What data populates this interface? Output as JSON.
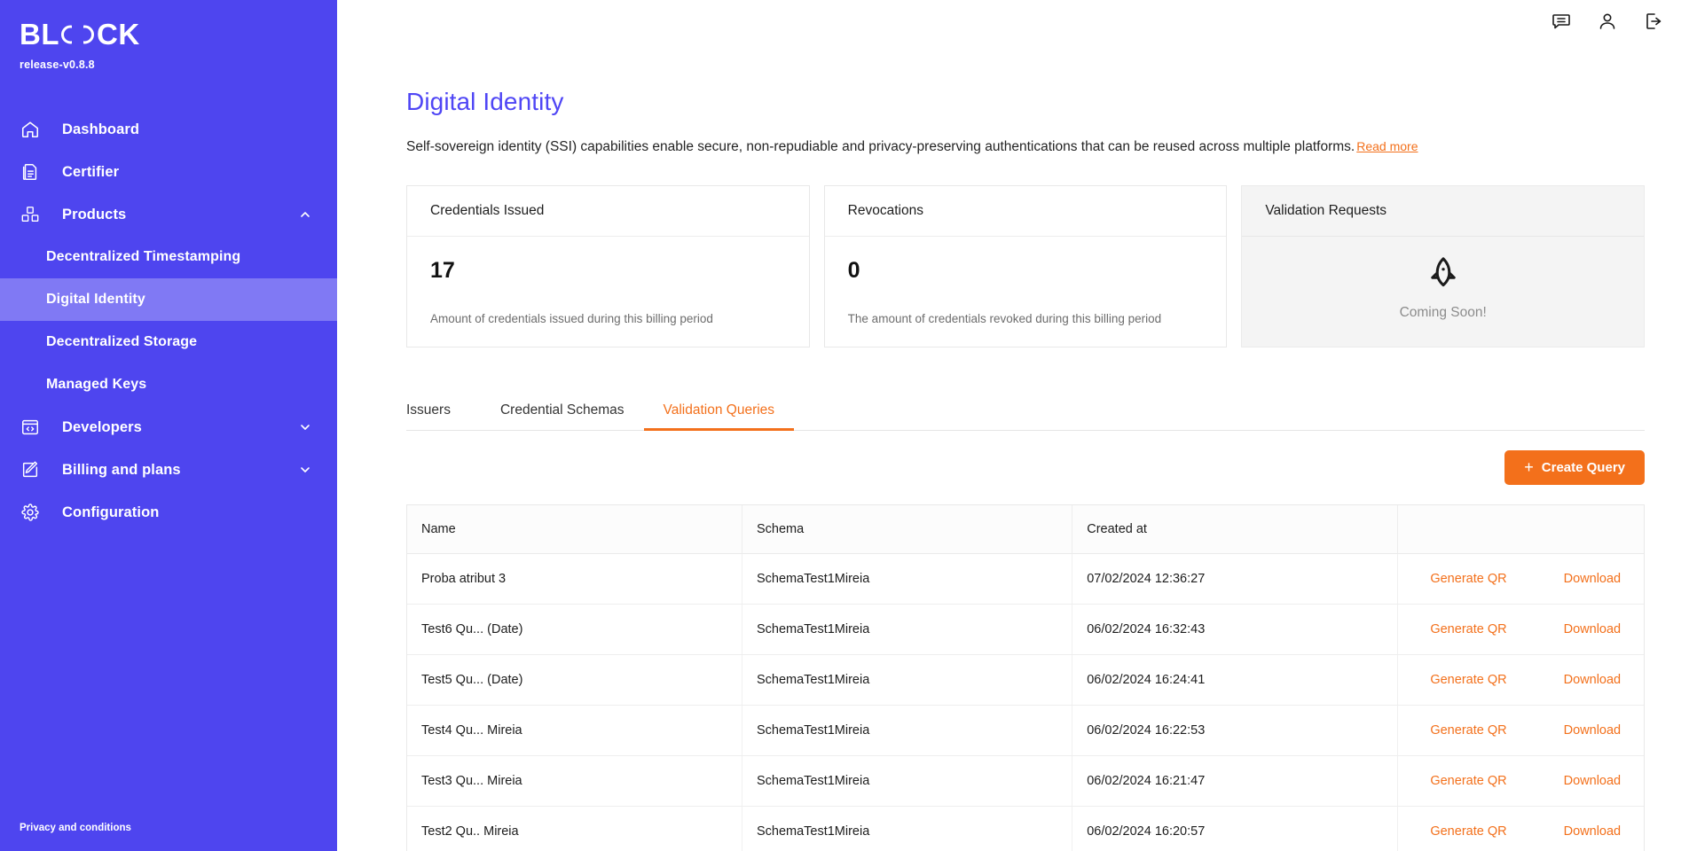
{
  "sidebar": {
    "logo_left": "BL",
    "logo_right": "CK",
    "release": "release-v0.8.8",
    "items": [
      {
        "label": "Dashboard",
        "icon": "home-icon",
        "type": "top"
      },
      {
        "label": "Certifier",
        "icon": "document-icon",
        "type": "top"
      },
      {
        "label": "Products",
        "icon": "boxes-icon",
        "type": "top",
        "chevron": "chevron-up-icon"
      },
      {
        "label": "Decentralized Timestamping",
        "icon": "",
        "type": "sub"
      },
      {
        "label": "Digital Identity",
        "icon": "",
        "type": "sub",
        "active": true
      },
      {
        "label": "Decentralized Storage",
        "icon": "",
        "type": "sub"
      },
      {
        "label": "Managed Keys",
        "icon": "",
        "type": "sub"
      },
      {
        "label": "Developers",
        "icon": "code-window-icon",
        "type": "top",
        "chevron": "chevron-down-icon"
      },
      {
        "label": "Billing and plans",
        "icon": "edit-square-icon",
        "type": "top",
        "chevron": "chevron-down-icon"
      },
      {
        "label": "Configuration",
        "icon": "gear-icon",
        "type": "top"
      }
    ],
    "footer": "Privacy and conditions"
  },
  "topbar": {
    "icons": [
      "chat-icon",
      "user-icon",
      "logout-icon"
    ]
  },
  "page": {
    "title": "Digital Identity",
    "description": "Self-sovereign identity (SSI) capabilities enable secure, non-repudiable and privacy-preserving authentications that can be reused across multiple platforms.",
    "read_more": "Read more"
  },
  "cards": [
    {
      "title": "Credentials Issued",
      "value": "17",
      "subtitle": "Amount of credentials issued during this billing period"
    },
    {
      "title": "Revocations",
      "value": "0",
      "subtitle": "The amount of credentials revoked during this billing period"
    },
    {
      "title": "Validation Requests",
      "coming_soon": "Coming Soon!",
      "icon": "rocket-icon"
    }
  ],
  "tabs": [
    {
      "label": "Issuers",
      "active": false
    },
    {
      "label": "Credential Schemas",
      "active": false
    },
    {
      "label": "Validation Queries",
      "active": true
    }
  ],
  "actions": {
    "create_query": "Create Query",
    "plus": "+"
  },
  "table": {
    "columns": [
      "Name",
      "Schema",
      "Created at",
      ""
    ],
    "action_labels": {
      "generate_qr": "Generate QR",
      "download": "Download"
    },
    "rows": [
      {
        "name": "Proba atribut 3",
        "schema": "SchemaTest1Mireia",
        "created_at": "07/02/2024 12:36:27"
      },
      {
        "name": "Test6 Qu... (Date)",
        "schema": "SchemaTest1Mireia",
        "created_at": "06/02/2024 16:32:43"
      },
      {
        "name": "Test5 Qu... (Date)",
        "schema": "SchemaTest1Mireia",
        "created_at": "06/02/2024 16:24:41"
      },
      {
        "name": "Test4 Qu... Mireia",
        "schema": "SchemaTest1Mireia",
        "created_at": "06/02/2024 16:22:53"
      },
      {
        "name": "Test3 Qu... Mireia",
        "schema": "SchemaTest1Mireia",
        "created_at": "06/02/2024 16:21:47"
      },
      {
        "name": "Test2 Qu.. Mireia",
        "schema": "SchemaTest1Mireia",
        "created_at": "06/02/2024 16:20:57"
      }
    ]
  },
  "colors": {
    "sidebar_bg": "#4E45EF",
    "sidebar_active": "#8079F4",
    "accent_orange": "#F3701B",
    "title_blue": "#4F46F5"
  }
}
